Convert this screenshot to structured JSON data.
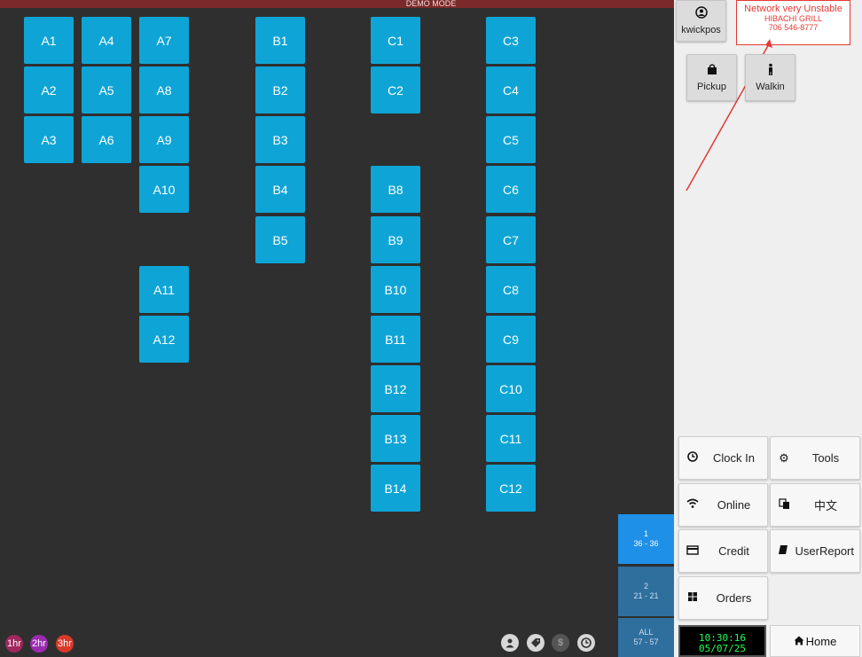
{
  "banner": {
    "text": "DEMO MODE"
  },
  "tables": {
    "A1": "A1",
    "A2": "A2",
    "A3": "A3",
    "A4": "A4",
    "A5": "A5",
    "A6": "A6",
    "A7": "A7",
    "A8": "A8",
    "A9": "A9",
    "A10": "A10",
    "A11": "A11",
    "A12": "A12",
    "B1": "B1",
    "B2": "B2",
    "B3": "B3",
    "B4": "B4",
    "B5": "B5",
    "B8": "B8",
    "B9": "B9",
    "B10": "B10",
    "B11": "B11",
    "B12": "B12",
    "B13": "B13",
    "B14": "B14",
    "C1": "C1",
    "C2": "C2",
    "C3": "C3",
    "C4": "C4",
    "C5": "C5",
    "C6": "C6",
    "C7": "C7",
    "C8": "C8",
    "C9": "C9",
    "C10": "C10",
    "C11": "C11",
    "C12": "C12"
  },
  "user": {
    "name": "kwickpos",
    "icon": "user-circle-icon"
  },
  "notice": {
    "warning": "Network very Unstable",
    "restaurant": "HIBACHI GRILL",
    "phone": "706 546-8777"
  },
  "order_types": {
    "pickup": "Pickup",
    "walkin": "Walkin"
  },
  "actions": {
    "clock_in": "Clock In",
    "tools": "Tools",
    "online": "Online",
    "language": "中文",
    "credit": "Credit",
    "user_report": "UserReport",
    "orders": "Orders",
    "home": "Home"
  },
  "clock": {
    "time": "10:30:16",
    "date": "05/07/25"
  },
  "pages": [
    {
      "label": "1",
      "range": "36 - 36"
    },
    {
      "label": "2",
      "range": "21 - 21"
    },
    {
      "label": "ALL",
      "range": "57 - 57"
    }
  ],
  "timers": [
    "1hr",
    "2hr",
    "3hr"
  ],
  "timer_colors": [
    "#a0285c",
    "#9b2bb0",
    "#d83a2a"
  ],
  "bottom_icons": [
    "person-icon",
    "tag-icon",
    "dollar-icon",
    "clock-icon"
  ],
  "colors": {
    "table": "#0ea5d6",
    "page_active": "#1e90e8",
    "page_inactive": "#2f6f9e",
    "clock_text": "#22ff55",
    "alert": "#e53935"
  }
}
